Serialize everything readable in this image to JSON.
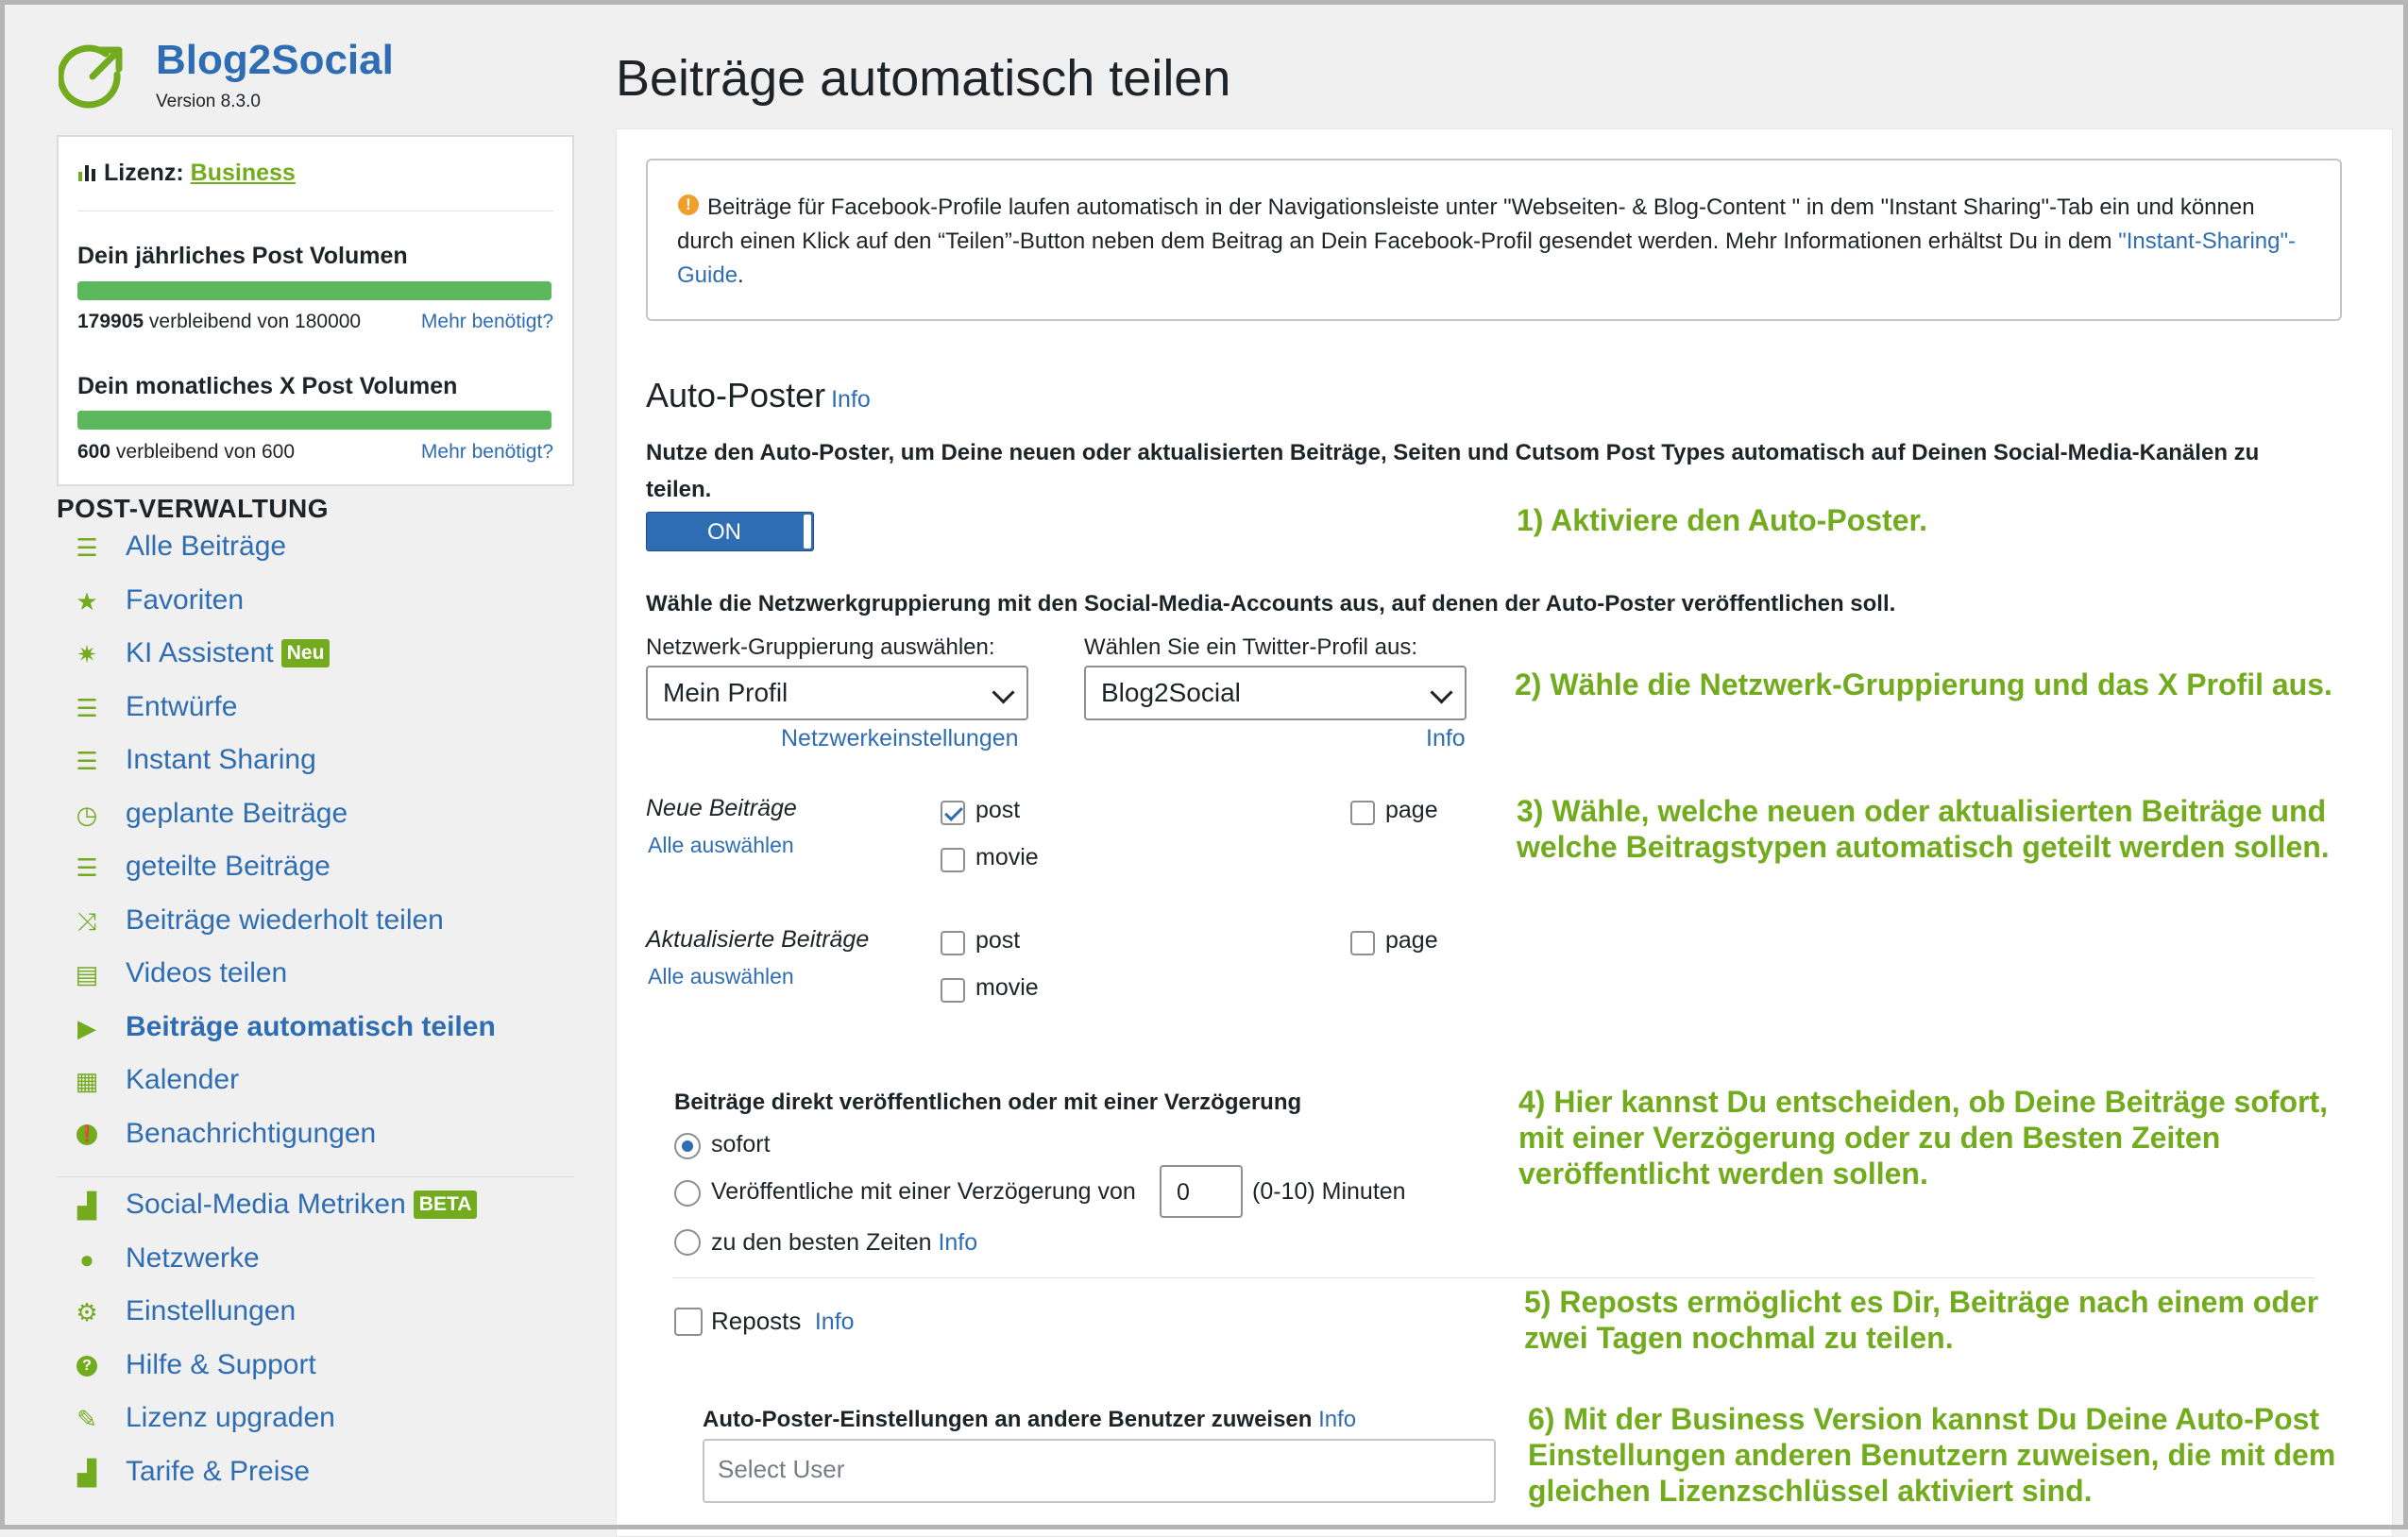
{
  "brand": {
    "name": "Blog2Social",
    "version": "Version 8.3.0",
    "accent": "#72ab1e",
    "blue": "#2f6db3"
  },
  "license": {
    "label": "Lizenz:",
    "plan": "Business",
    "yearly": {
      "title": "Dein jährliches Post Volumen",
      "remaining": "179905",
      "suffix": "verbleibend von 180000",
      "more": "Mehr benötigt?",
      "fraction": 0.9995
    },
    "monthly": {
      "title": "Dein monatliches X Post Volumen",
      "remaining": "600",
      "suffix": "verbleibend von 600",
      "more": "Mehr benötigt?",
      "fraction": 1.0
    }
  },
  "nav": {
    "section_title": "POST-VERWALTUNG",
    "items": [
      {
        "label": "Alle Beiträge",
        "icon": "list-icon"
      },
      {
        "label": "Favoriten",
        "icon": "star-icon"
      },
      {
        "label": "KI Assistent",
        "icon": "sparkle-icon",
        "badge": "Neu"
      },
      {
        "label": "Entwürfe",
        "icon": "list-icon"
      },
      {
        "label": "Instant Sharing",
        "icon": "list-icon"
      },
      {
        "label": "geplante Beiträge",
        "icon": "clock-icon"
      },
      {
        "label": "geteilte Beiträge",
        "icon": "list-icon"
      },
      {
        "label": "Beiträge wiederholt teilen",
        "icon": "shuffle-icon"
      },
      {
        "label": "Videos teilen",
        "icon": "film-icon"
      },
      {
        "label": "Beiträge automatisch teilen",
        "icon": "play-icon",
        "active": true
      },
      {
        "label": "Kalender",
        "icon": "calendar-icon"
      },
      {
        "label": "Benachrichtigungen",
        "icon": "alert-icon"
      }
    ],
    "items2": [
      {
        "label": "Social-Media Metriken",
        "icon": "bar-chart-icon",
        "badge": "BETA"
      },
      {
        "label": "Netzwerke",
        "icon": "user-icon"
      },
      {
        "label": "Einstellungen",
        "icon": "gear-icon"
      },
      {
        "label": "Hilfe & Support",
        "icon": "help-icon"
      },
      {
        "label": "Lizenz upgraden",
        "icon": "pencil-icon"
      },
      {
        "label": "Tarife & Preise",
        "icon": "bar-chart-icon"
      }
    ]
  },
  "page": {
    "title": "Beiträge automatisch teilen",
    "notice": {
      "text": "Beiträge für Facebook-Profile laufen automatisch in der Navigationsleiste unter \"Webseiten- & Blog-Content \" in dem \"Instant Sharing\"-Tab ein und können durch einen Klick auf den “Teilen”-Button neben dem Beitrag an Dein Facebook-Profil gesendet werden. Mehr Informationen erhältst Du in dem ",
      "link": "\"Instant-Sharing\"-Guide",
      "end": "."
    },
    "autoposter": {
      "heading": "Auto-Poster",
      "info": "Info",
      "intro": "Nutze den Auto-Poster, um Deine neuen oder aktualisierten Beiträge, Seiten und Cutsom Post Types automatisch auf Deinen Social-Media-Kanälen zu teilen.",
      "toggle": "ON"
    },
    "grouping": {
      "lead": "Wähle die Netzwerkgruppierung mit den Social-Media-Accounts aus, auf denen der Auto-Poster veröffentlichen soll.",
      "network_label": "Netzwerk-Gruppierung auswählen:",
      "network_value": "Mein Profil",
      "network_link": "Netzwerkeinstellungen",
      "twitter_label": "Wählen Sie ein Twitter-Profil aus:",
      "twitter_value": "Blog2Social",
      "twitter_link": "Info"
    },
    "new_posts": {
      "label": "Neue Beiträge",
      "select_all": "Alle auswählen",
      "post": "post",
      "page": "page",
      "movie": "movie"
    },
    "updated_posts": {
      "label": "Aktualisierte Beiträge",
      "select_all": "Alle auswählen",
      "post": "post",
      "page": "page",
      "movie": "movie"
    },
    "delay": {
      "title": "Beiträge direkt veröffentlichen oder mit einer Verzögerung",
      "opt_now": "sofort",
      "opt_delay": "Veröffentliche mit einer Verzögerung von",
      "delay_value": "0",
      "delay_unit": "(0-10) Minuten",
      "opt_best": "zu den besten Zeiten",
      "best_info": "Info"
    },
    "reposts": {
      "label": "Reposts",
      "info": "Info"
    },
    "assign": {
      "title": "Auto-Poster-Einstellungen an andere Benutzer zuweisen",
      "info": "Info",
      "placeholder": "Select User"
    },
    "annotations": {
      "a1": "1) Aktiviere den Auto-Poster.",
      "a2": "2) Wähle die Netzwerk-Gruppierung und das X Profil aus.",
      "a3": "3) Wähle, welche neuen oder aktualisierten Beiträge und welche Beitragstypen automatisch geteilt werden sollen.",
      "a4": "4) Hier kannst Du entscheiden, ob Deine Beiträge sofort, mit einer Verzögerung oder zu den Besten Zeiten veröffentlicht werden sollen.",
      "a5": "5) Reposts ermöglicht es Dir, Beiträge nach einem oder zwei Tagen nochmal zu teilen.",
      "a6": "6) Mit der Business Version kannst Du Deine Auto-Post Einstellungen anderen Benutzern zuweisen, die mit dem gleichen Lizenzschlüssel aktiviert sind."
    }
  }
}
